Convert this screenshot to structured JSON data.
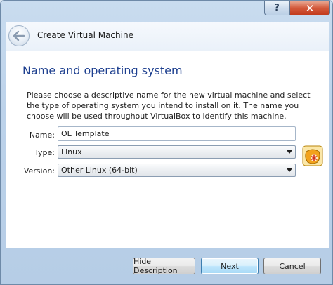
{
  "window": {
    "help_label": "?",
    "close_label": "✕"
  },
  "header": {
    "title": "Create Virtual Machine"
  },
  "section": {
    "title": "Name and operating system",
    "description": "Please choose a descriptive name for the new virtual machine and select the type of operating system you intend to install on it. The name you choose will be used throughout VirtualBox to identify this machine."
  },
  "form": {
    "name_label": "Name:",
    "name_value": "OL Template",
    "type_label": "Type:",
    "type_value": "Linux",
    "version_label": "Version:",
    "version_value": "Other Linux (64-bit)"
  },
  "buttons": {
    "hide_description": "Hide Description",
    "next": "Next",
    "cancel": "Cancel"
  },
  "icons": {
    "back": "back-arrow-icon",
    "os": "linux-os-icon",
    "os_color": "#f2a21c"
  }
}
